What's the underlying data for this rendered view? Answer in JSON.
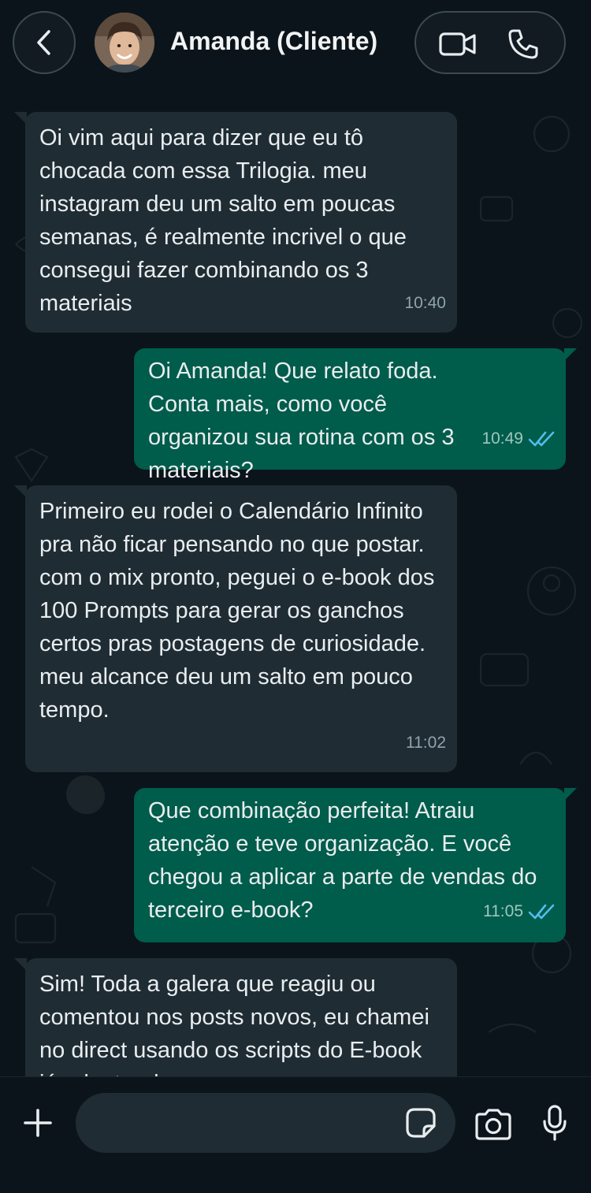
{
  "header": {
    "contact_name": "Amanda (Cliente)"
  },
  "messages": [
    {
      "direction": "in",
      "text": "Oi vim aqui para dizer que eu tô chocada com essa Trilogia. meu instagram deu um salto em poucas semanas, é realmente incrivel o que consegui fazer combinando os 3 materiais",
      "time": "10:40"
    },
    {
      "direction": "out",
      "text": "Oi Amanda! Que relato foda. Conta mais, como você organizou sua rotina com os 3 materiais?",
      "time": "10:49",
      "status": "read"
    },
    {
      "direction": "in",
      "text": "Primeiro eu rodei o Calendário Infinito pra não ficar pensando no que postar. com o mix pronto, peguei o e-book dos 100 Prompts para gerar os ganchos certos pras postagens de curiosidade. meu alcance deu um salto em pouco tempo.",
      "time": "11:02"
    },
    {
      "direction": "out",
      "text": "Que combinação perfeita! Atraiu atenção e teve organização. E você chegou a aplicar a parte de vendas do terceiro e-book?",
      "time": "11:05",
      "status": "read"
    },
    {
      "direction": "in",
      "text": "Sim! Toda a galera que reagiu ou comentou nos posts novos, eu chamei no direct usando os scripts do E-book já adaptando...",
      "time": ""
    }
  ],
  "composer": {
    "placeholder": ""
  },
  "colors": {
    "background": "#0b141a",
    "incoming_bubble": "#1f2c34",
    "outgoing_bubble": "#005c4b",
    "read_ticks": "#53bdeb"
  }
}
